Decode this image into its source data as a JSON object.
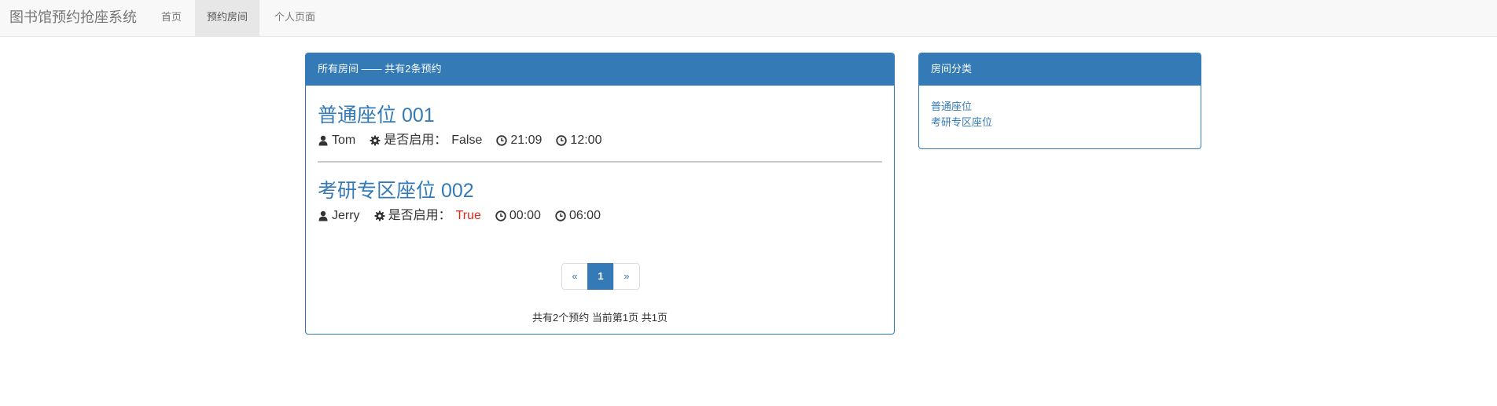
{
  "app": {
    "brand": "图书馆预约抢座系统"
  },
  "nav": {
    "items": [
      {
        "label": "首页",
        "active": false
      },
      {
        "label": "预约房间",
        "active": true
      },
      {
        "label": "个人页面",
        "active": false
      }
    ]
  },
  "main_panel": {
    "heading": "所有房间 —— 共有2条预约",
    "rooms": [
      {
        "title": "普通座位 001",
        "user": "Tom",
        "enabled_label": "是否启用：",
        "enabled_value": "False",
        "start_time": "21:09",
        "end_time": "12:00"
      },
      {
        "title": "考研专区座位 002",
        "user": "Jerry",
        "enabled_label": "是否启用：",
        "enabled_value": "True",
        "start_time": "00:00",
        "end_time": "06:00"
      }
    ],
    "pagination": {
      "prev": "«",
      "current": "1",
      "next": "»"
    },
    "page_info": "共有2个预约 当前第1页 共1页"
  },
  "side_panel": {
    "heading": "房间分类",
    "categories": [
      "普通座位",
      "考研专区座位"
    ]
  },
  "colors": {
    "primary": "#337ab7",
    "navbar_bg": "#f8f8f8",
    "true_status": "#e0261a"
  },
  "icons": {
    "user": "user-icon",
    "gear": "gear-icon",
    "clock": "clock-icon"
  }
}
